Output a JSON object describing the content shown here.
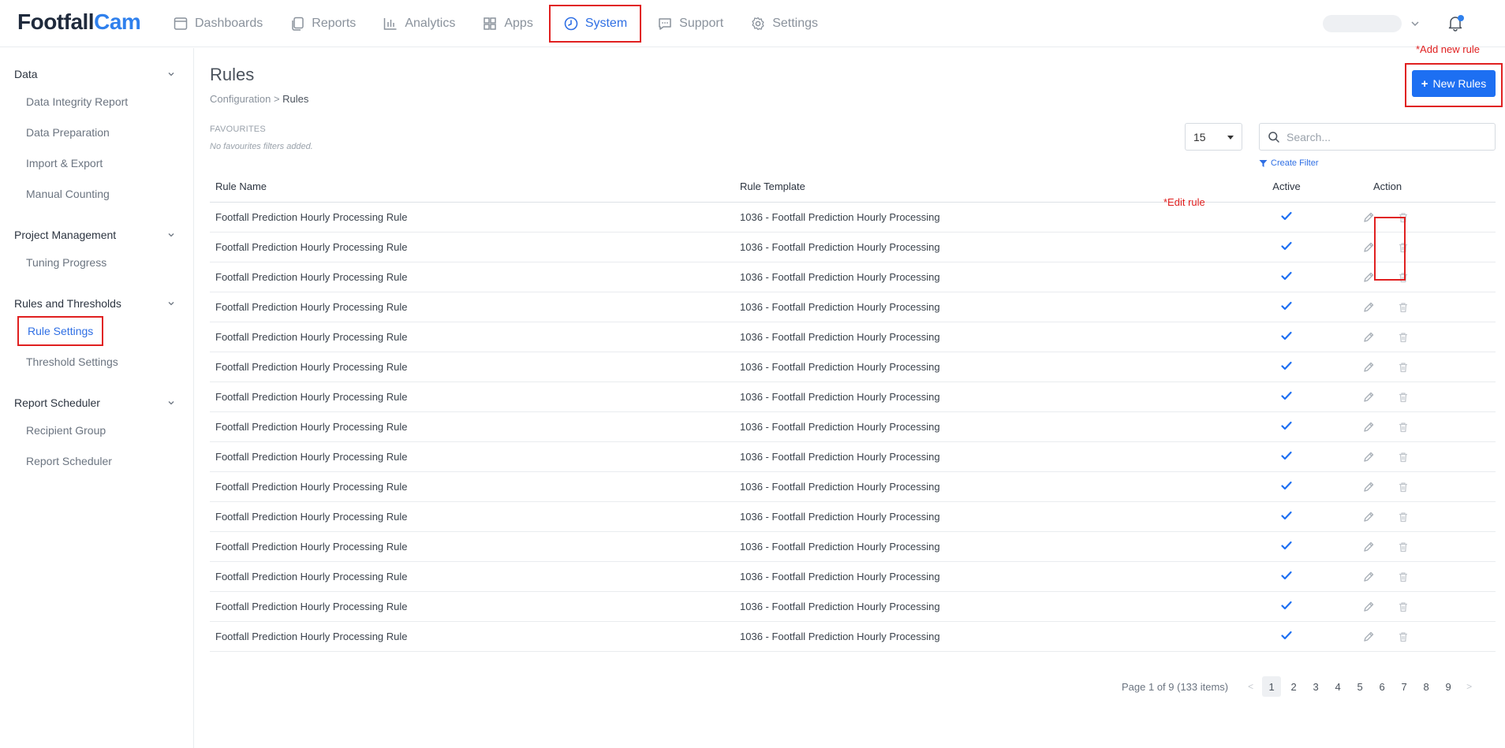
{
  "brand": {
    "part1": "Footfall",
    "part2": "Cam"
  },
  "nav": [
    {
      "label": "Dashboards",
      "icon": "dashboard-icon",
      "active": false
    },
    {
      "label": "Reports",
      "icon": "reports-icon",
      "active": false
    },
    {
      "label": "Analytics",
      "icon": "analytics-icon",
      "active": false
    },
    {
      "label": "Apps",
      "icon": "apps-icon",
      "active": false
    },
    {
      "label": "System",
      "icon": "system-icon",
      "active": true
    },
    {
      "label": "Support",
      "icon": "support-icon",
      "active": false
    },
    {
      "label": "Settings",
      "icon": "settings-icon",
      "active": false
    }
  ],
  "sidebar": {
    "groups": [
      {
        "label": "Data",
        "items": [
          {
            "label": "Data Integrity Report"
          },
          {
            "label": "Data Preparation"
          },
          {
            "label": "Import & Export"
          },
          {
            "label": "Manual Counting"
          }
        ]
      },
      {
        "label": "Project Management",
        "items": [
          {
            "label": "Tuning Progress"
          }
        ]
      },
      {
        "label": "Rules and Thresholds",
        "items": [
          {
            "label": "Rule Settings",
            "active": true
          },
          {
            "label": "Threshold Settings"
          }
        ]
      },
      {
        "label": "Report Scheduler",
        "items": [
          {
            "label": "Recipient Group"
          },
          {
            "label": "Report Scheduler"
          }
        ]
      }
    ]
  },
  "page": {
    "title": "Rules",
    "breadcrumb_parent": "Configuration",
    "breadcrumb_sep": ">",
    "breadcrumb_current": "Rules",
    "favourites_title": "FAVOURITES",
    "favourites_empty": "No favourites filters added."
  },
  "annotations": {
    "add_new_rule": "*Add new rule",
    "edit_rule": "*Edit rule"
  },
  "toolbar": {
    "new_rules_label": "New Rules",
    "page_size": "15",
    "search_placeholder": "Search...",
    "create_filter_label": "Create Filter"
  },
  "table": {
    "headers": {
      "name": "Rule Name",
      "template": "Rule Template",
      "active": "Active",
      "action": "Action"
    },
    "rows": [
      {
        "name": "Footfall Prediction Hourly Processing Rule",
        "template": "1036 - Footfall Prediction Hourly Processing",
        "active": true
      },
      {
        "name": "Footfall Prediction Hourly Processing Rule",
        "template": "1036 - Footfall Prediction Hourly Processing",
        "active": true
      },
      {
        "name": "Footfall Prediction Hourly Processing Rule",
        "template": "1036 - Footfall Prediction Hourly Processing",
        "active": true
      },
      {
        "name": "Footfall Prediction Hourly Processing Rule",
        "template": "1036 - Footfall Prediction Hourly Processing",
        "active": true
      },
      {
        "name": "Footfall Prediction Hourly Processing Rule",
        "template": "1036 - Footfall Prediction Hourly Processing",
        "active": true
      },
      {
        "name": "Footfall Prediction Hourly Processing Rule",
        "template": "1036 - Footfall Prediction Hourly Processing",
        "active": true
      },
      {
        "name": "Footfall Prediction Hourly Processing Rule",
        "template": "1036 - Footfall Prediction Hourly Processing",
        "active": true
      },
      {
        "name": "Footfall Prediction Hourly Processing Rule",
        "template": "1036 - Footfall Prediction Hourly Processing",
        "active": true
      },
      {
        "name": "Footfall Prediction Hourly Processing Rule",
        "template": "1036 - Footfall Prediction Hourly Processing",
        "active": true
      },
      {
        "name": "Footfall Prediction Hourly Processing Rule",
        "template": "1036 - Footfall Prediction Hourly Processing",
        "active": true
      },
      {
        "name": "Footfall Prediction Hourly Processing Rule",
        "template": "1036 - Footfall Prediction Hourly Processing",
        "active": true
      },
      {
        "name": "Footfall Prediction Hourly Processing Rule",
        "template": "1036 - Footfall Prediction Hourly Processing",
        "active": true
      },
      {
        "name": "Footfall Prediction Hourly Processing Rule",
        "template": "1036 - Footfall Prediction Hourly Processing",
        "active": true
      },
      {
        "name": "Footfall Prediction Hourly Processing Rule",
        "template": "1036 - Footfall Prediction Hourly Processing",
        "active": true
      },
      {
        "name": "Footfall Prediction Hourly Processing Rule",
        "template": "1036 - Footfall Prediction Hourly Processing",
        "active": true
      }
    ]
  },
  "pagination": {
    "info": "Page 1 of 9 (133 items)",
    "pages": [
      "1",
      "2",
      "3",
      "4",
      "5",
      "6",
      "7",
      "8",
      "9"
    ],
    "current": "1",
    "prev": "<",
    "next": ">"
  },
  "colors": {
    "accent": "#2f6fe4",
    "primary_button": "#1d6ff2",
    "annotation": "#e02020"
  }
}
